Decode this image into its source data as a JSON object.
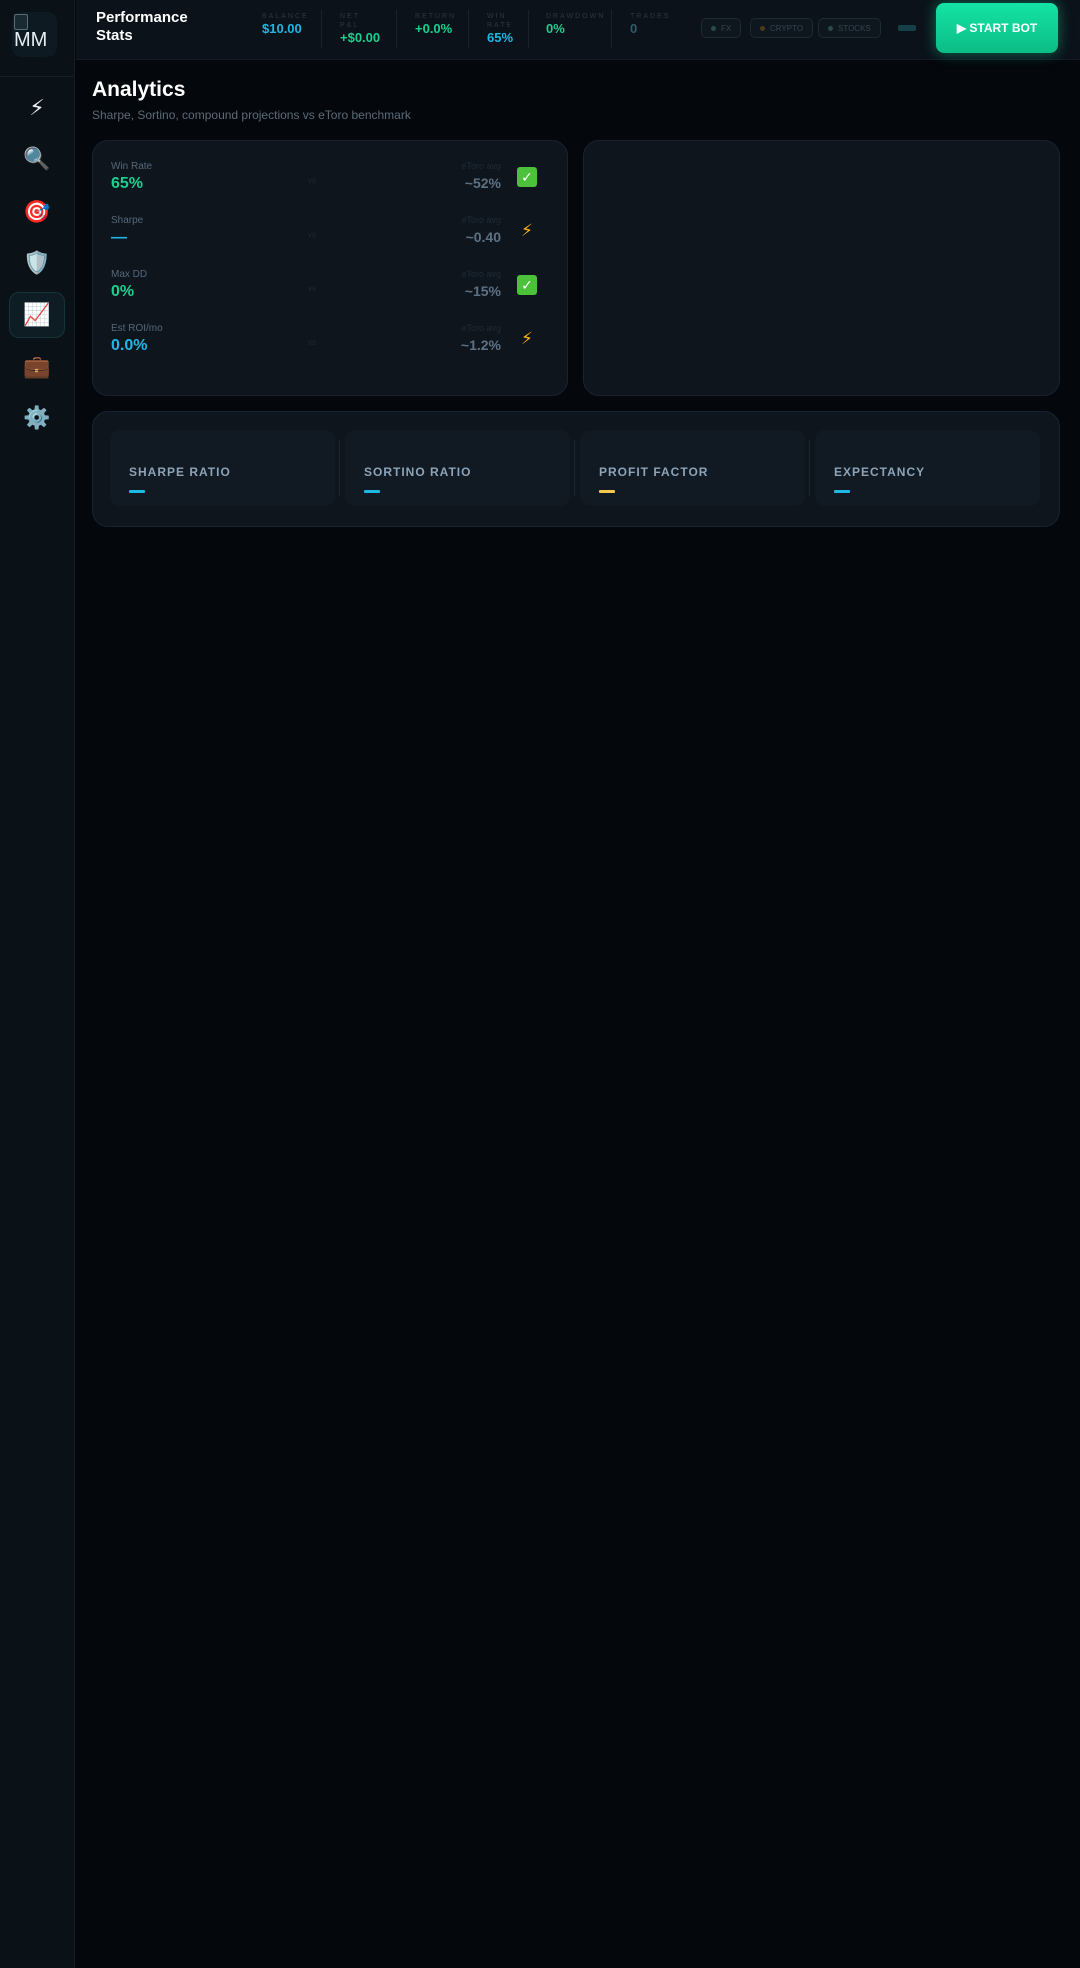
{
  "sidebar": {
    "logo_alt": "MM",
    "items": [
      {
        "name": "lightning",
        "glyph": "⚡"
      },
      {
        "name": "search",
        "glyph": "🔍"
      },
      {
        "name": "target",
        "glyph": "🎯"
      },
      {
        "name": "shield",
        "glyph": "🛡️"
      },
      {
        "name": "chart",
        "glyph": "📈"
      },
      {
        "name": "briefcase",
        "glyph": "💼"
      },
      {
        "name": "gear",
        "glyph": "⚙️"
      }
    ]
  },
  "header": {
    "title": "Performance Stats",
    "stats": [
      {
        "label": "BALANCE",
        "value": "$10.00",
        "color": "#1fb8e6"
      },
      {
        "label": "NET P&L",
        "value": "+$0.00",
        "color": "#19d08f"
      },
      {
        "label": "RETURN",
        "value": "+0.0%",
        "color": "#19d08f"
      },
      {
        "label": "WIN RATE",
        "value": "65%",
        "color": "#1fb8e6"
      },
      {
        "label": "DRAWDOWN",
        "value": "0%",
        "color": "#19d08f"
      },
      {
        "label": "TRADES",
        "value": "0",
        "color": "#2f5c6d"
      }
    ],
    "pills": [
      "FX",
      "CRYPTO",
      "STOCKS"
    ],
    "start_button": "▶ START BOT"
  },
  "page": {
    "title": "Analytics",
    "subtitle": "Sharpe, Sortino, compound projections vs eToro benchmark"
  },
  "benchmark": {
    "rows": [
      {
        "name": "Win Rate",
        "ours": "65%",
        "ours_color": "#19d08f",
        "vs": "vs",
        "etoro_label": "eToro avg",
        "etoro": "~52%",
        "icon": "check"
      },
      {
        "name": "Sharpe",
        "ours": "—",
        "ours_color": "#1fb8e6",
        "vs": "vs",
        "etoro_label": "eToro avg",
        "etoro": "~0.40",
        "icon": "bolt"
      },
      {
        "name": "Max DD",
        "ours": "0%",
        "ours_color": "#19d08f",
        "vs": "vs",
        "etoro_label": "eToro avg",
        "etoro": "~15%",
        "icon": "check"
      },
      {
        "name": "Est ROI/mo",
        "ours": "0.0%",
        "ours_color": "#1fb8e6",
        "vs": "vs",
        "etoro_label": "eToro avg",
        "etoro": "~1.2%",
        "icon": "bolt"
      }
    ]
  },
  "metrics": [
    {
      "label": "SHARPE RATIO",
      "dash_color": "#1fb8e6"
    },
    {
      "label": "SORTINO RATIO",
      "dash_color": "#1fb8e6"
    },
    {
      "label": "PROFIT FACTOR",
      "dash_color": "#f2c94c"
    },
    {
      "label": "EXPECTANCY",
      "dash_color": "#1fb8e6"
    }
  ]
}
